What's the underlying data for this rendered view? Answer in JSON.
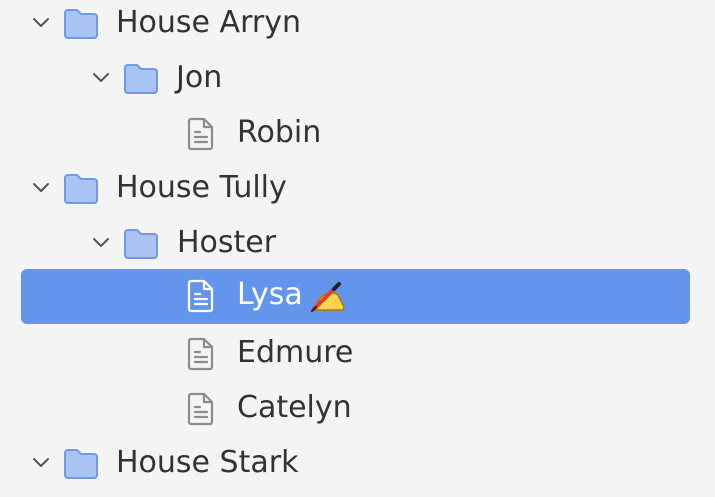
{
  "tree": {
    "rows": [
      {
        "label": "House Arryn",
        "type": "folder",
        "depth": 0,
        "expanded": true,
        "selected": false,
        "icon": "folder-icon"
      },
      {
        "label": "Jon",
        "type": "folder",
        "depth": 1,
        "expanded": true,
        "selected": false,
        "icon": "folder-icon"
      },
      {
        "label": "Robin",
        "type": "file",
        "depth": 2,
        "selected": false,
        "icon": "document-icon"
      },
      {
        "label": "House Tully",
        "type": "folder",
        "depth": 0,
        "expanded": true,
        "selected": false,
        "icon": "folder-icon"
      },
      {
        "label": "Hoster",
        "type": "folder",
        "depth": 1,
        "expanded": true,
        "selected": false,
        "icon": "folder-icon"
      },
      {
        "label": "Lysa",
        "type": "file",
        "depth": 2,
        "selected": true,
        "icon": "document-icon",
        "badge_icon": "edit-pencil-icon"
      },
      {
        "label": "Edmure",
        "type": "file",
        "depth": 2,
        "selected": false,
        "icon": "document-icon"
      },
      {
        "label": "Catelyn",
        "type": "file",
        "depth": 2,
        "selected": false,
        "icon": "document-icon"
      },
      {
        "label": "House Stark",
        "type": "folder",
        "depth": 0,
        "expanded": true,
        "selected": false,
        "icon": "folder-icon"
      }
    ]
  },
  "colors": {
    "background": "#f4f4f4",
    "selection": "#6495ed",
    "text": "#333333",
    "selected_text": "#ffffff",
    "folder_fill": "#a9c3f2",
    "folder_stroke": "#6f98e6",
    "file_stroke": "#8c8c8c"
  }
}
